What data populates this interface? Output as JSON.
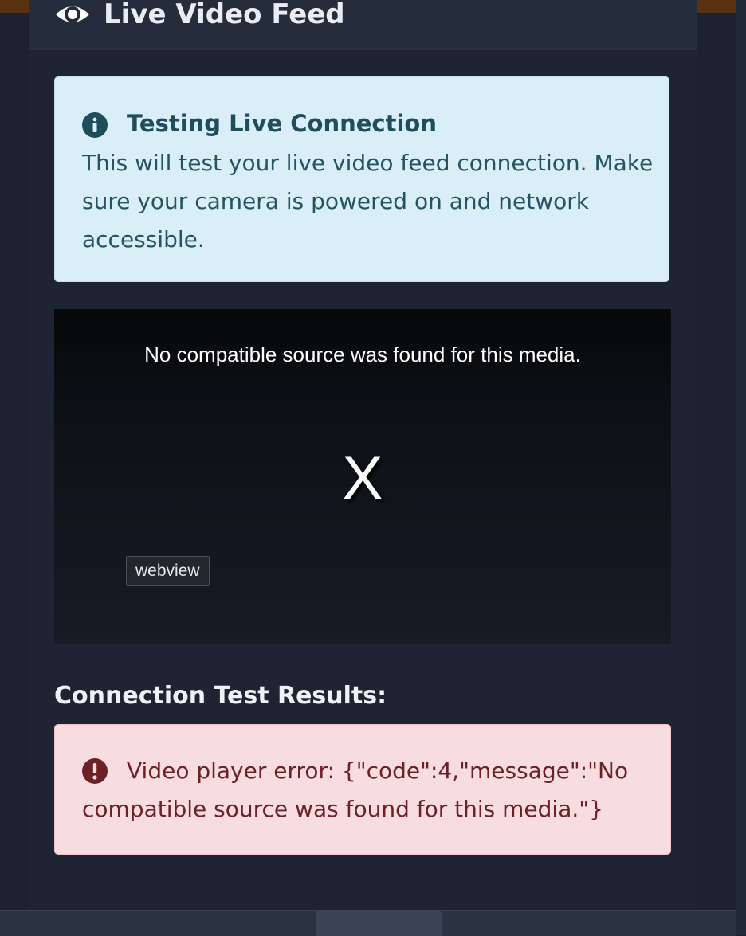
{
  "panel": {
    "title": "Live Video Feed",
    "icon": "eye-icon"
  },
  "info": {
    "icon": "info-circle-icon",
    "title": "Testing Live Connection",
    "text": "This will test your live video feed connection. Make sure your camera is powered on and network accessible."
  },
  "video": {
    "message": "No compatible source was found for this media.",
    "close_glyph": "X",
    "webview_label": "webview"
  },
  "results": {
    "title": "Connection Test Results:",
    "error_icon": "exclamation-circle-icon",
    "error_text": "Video player error: {\"code\":4,\"message\":\"No compatible source was found for this media.\"}"
  },
  "colors": {
    "info_bg": "#d9eef7",
    "error_bg": "#f8dde0",
    "page_bg": "#1c2230"
  }
}
